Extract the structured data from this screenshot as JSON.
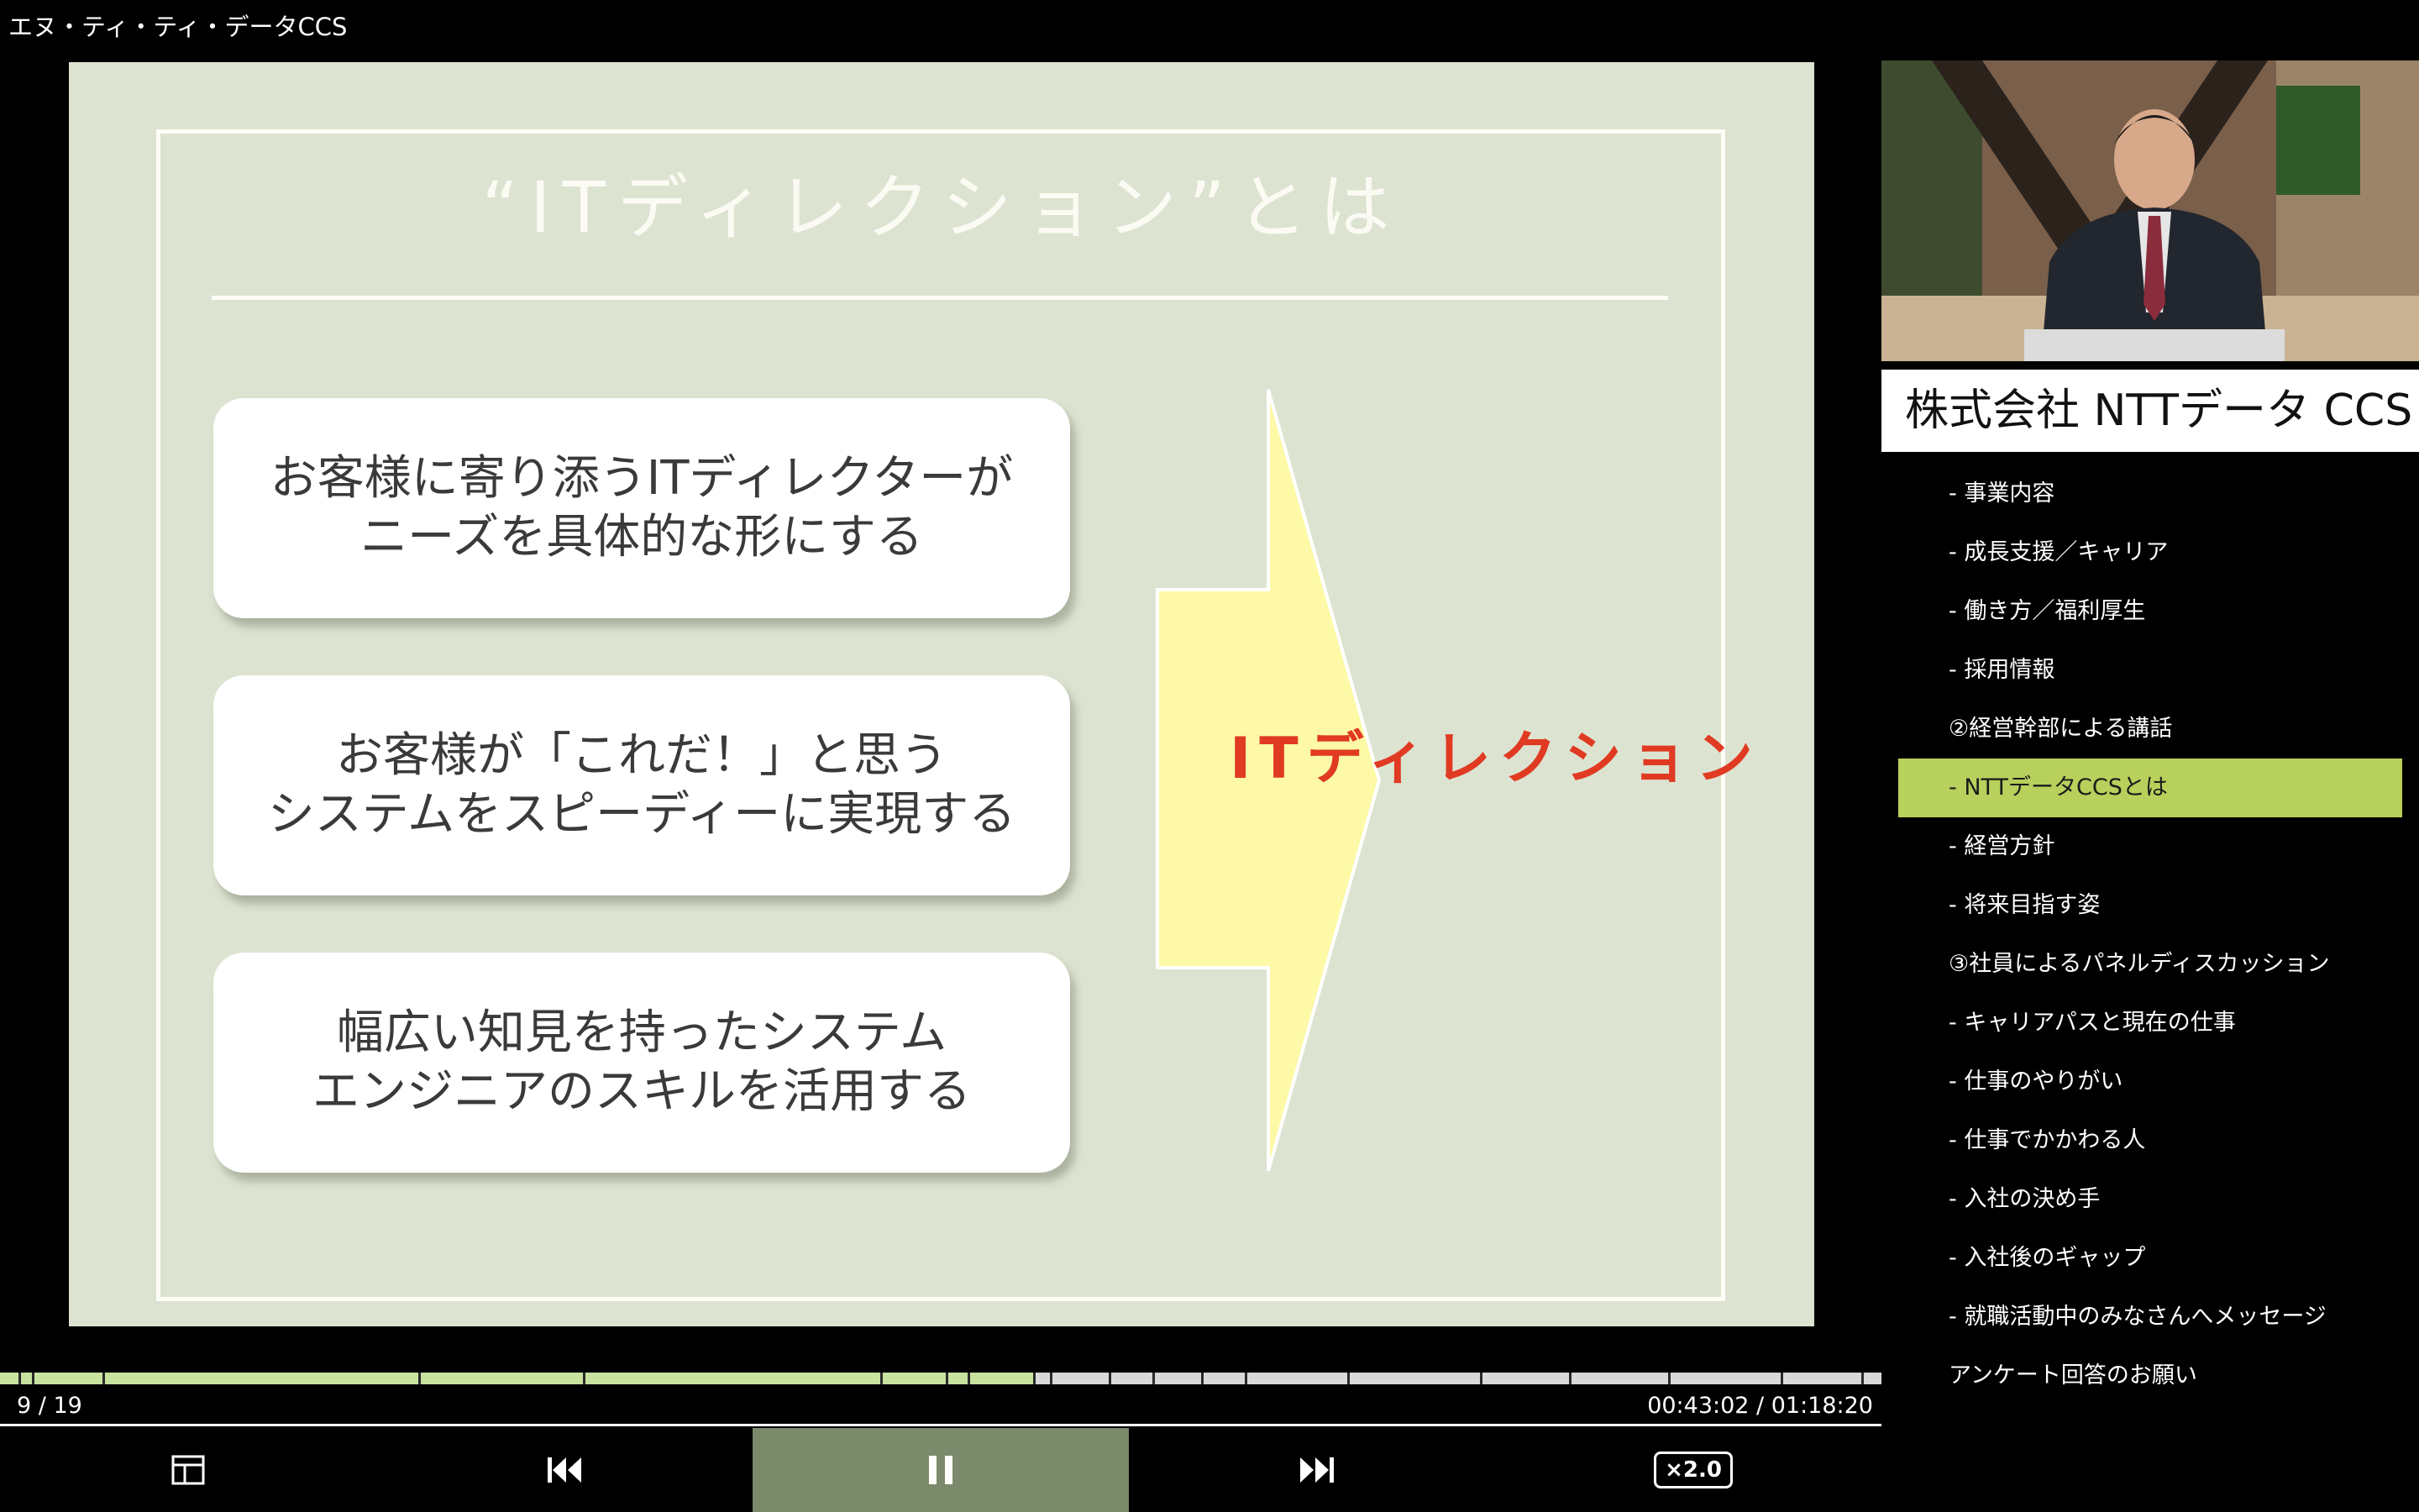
{
  "app": {
    "title": "エヌ・ティ・ティ・データCCS"
  },
  "slide": {
    "title": "“ITディレクション”とは",
    "boxes": [
      "お客様に寄り添うITディレクターが\nニーズを具体的な形にする",
      "お客様が「これだ！」と思う\nシステムをスピーディーに実現する",
      "幅広い知見を持ったシステム\nエンジニアのスキルを活用する"
    ],
    "arrow_label": "ITディレクション"
  },
  "presenter": {
    "company": "株式会社 NTTデータ CCS"
  },
  "chapters": [
    {
      "label": "- 事業内容",
      "active": false
    },
    {
      "label": "- 成長支援／キャリア",
      "active": false
    },
    {
      "label": "- 働き方／福利厚生",
      "active": false
    },
    {
      "label": "- 採用情報",
      "active": false
    },
    {
      "label": "②経営幹部による講話",
      "active": false
    },
    {
      "label": "- NTTデータCCSとは",
      "active": true
    },
    {
      "label": "- 経営方針",
      "active": false
    },
    {
      "label": "- 将来目指す姿",
      "active": false
    },
    {
      "label": "③社員によるパネルディスカッション",
      "active": false
    },
    {
      "label": "- キャリアパスと現在の仕事",
      "active": false
    },
    {
      "label": "- 仕事のやりがい",
      "active": false
    },
    {
      "label": "- 仕事でかかわる人",
      "active": false
    },
    {
      "label": "- 入社の決め手",
      "active": false
    },
    {
      "label": "- 入社後のギャップ",
      "active": false
    },
    {
      "label": "- 就職活動中のみなさんへメッセージ",
      "active": false
    },
    {
      "label": "アンケート回答のお願い",
      "active": false
    }
  ],
  "player": {
    "slide_counter": "9 / 19",
    "time": "00:43:02 / 01:18:20",
    "progress_fraction": 0.549,
    "speed": "×2.0"
  },
  "icons": {
    "layout": "layout-icon",
    "prev": "skip-previous-icon",
    "pause": "pause-icon",
    "next": "skip-next-icon"
  },
  "colors": {
    "active_chapter": "#b8d05c",
    "pause_button_bg": "#7a8a6a",
    "progress_played": "#c8e3a0",
    "arrow_text": "#e03a22"
  }
}
